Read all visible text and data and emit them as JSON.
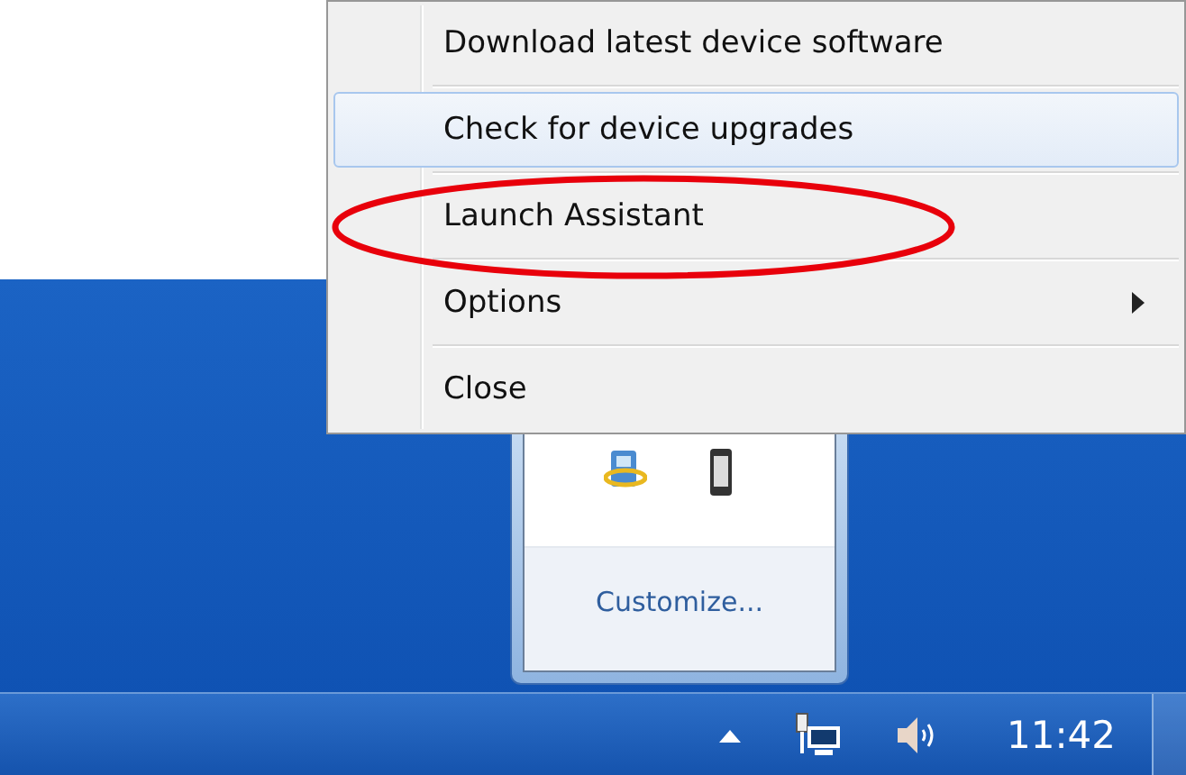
{
  "context_menu": {
    "items": [
      {
        "label": "Download latest device software",
        "kind": "command",
        "selected": false,
        "circled": false
      },
      {
        "label": "Check for device upgrades",
        "kind": "command",
        "selected": true,
        "circled": false
      },
      {
        "label": "Launch Assistant",
        "kind": "command",
        "selected": false,
        "circled": true
      },
      {
        "label": "Options",
        "kind": "submenu",
        "selected": false,
        "circled": false
      },
      {
        "label": "Close",
        "kind": "command",
        "selected": false,
        "circled": false
      }
    ]
  },
  "tray_overflow": {
    "link": "Customize..."
  },
  "taskbar": {
    "clock": "11:42"
  }
}
